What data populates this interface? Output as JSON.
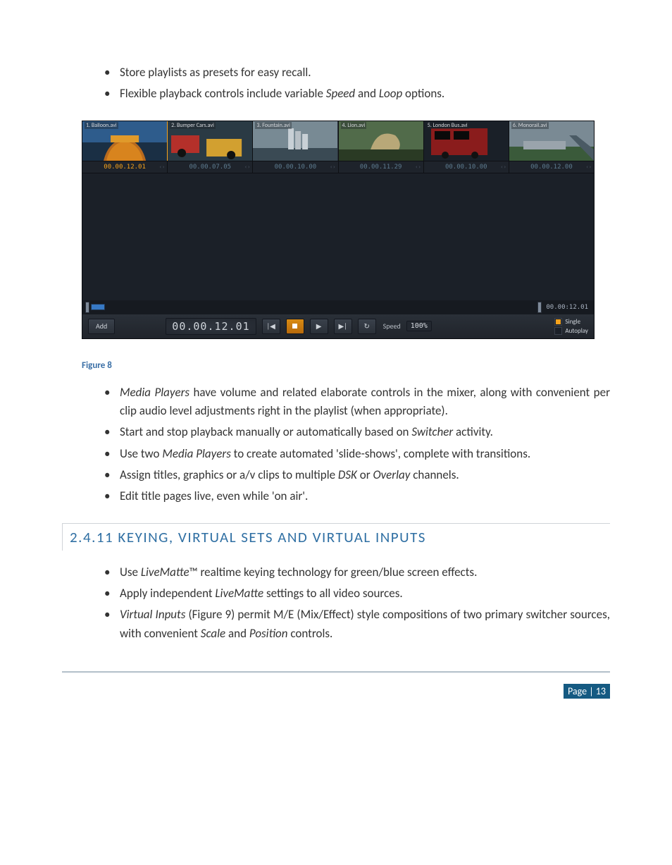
{
  "bullets_top": [
    "Store playlists as presets for easy recall.",
    "Flexible playback controls include variable <em>Speed</em> and <em>Loop</em> options."
  ],
  "figure": {
    "thumbs": [
      {
        "name": "1. Balloon.avi",
        "time": "00.00.12.01",
        "selected": true
      },
      {
        "name": "2. Bumper Cars.avi",
        "time": "00.00.07.05",
        "selected": false
      },
      {
        "name": "3. Fountain.avi",
        "time": "00.00.10.00",
        "selected": false
      },
      {
        "name": "4. Lion.avi",
        "time": "00.00.11.29",
        "selected": false
      },
      {
        "name": "5. London Bus.avi",
        "time": "00.00.10.00",
        "selected": false
      },
      {
        "name": "6. Monorail.avi",
        "time": "00.00.12.00",
        "selected": false
      }
    ],
    "track_dur": "00.00:12.01",
    "controls": {
      "add": "Add",
      "timecode": "00.00.12.01",
      "speed_label": "Speed",
      "speed_value": "100%",
      "chk_single": "Single",
      "chk_autoplay": "Autoplay"
    }
  },
  "caption": "Figure 8",
  "bullets_mid": [
    "<em>Media Players</em> have volume and related elaborate controls in the mixer, along with convenient per clip audio level adjustments right in the playlist (when appropriate).",
    "Start and stop playback manually or automatically based on <em>Switcher</em> activity.",
    "Use two <em>Media Players</em> to create automated 'slide-shows', complete with transitions.",
    "Assign titles, graphics or a/v clips to multiple <em>DSK</em> or <em>Overlay</em> channels.",
    "Edit title pages live, even while 'on air'."
  ],
  "section": "2.4.11 KEYING, VIRTUAL SETS AND VIRTUAL INPUTS",
  "bullets_bot": [
    "Use <em>LiveMatte</em>™ realtime keying technology for green/blue screen effects.",
    "Apply independent <em>LiveMatte</em> settings to all video sources.",
    "<em>Virtual Inputs</em> (Figure 9) permit M/E (Mix/Effect) style compositions of two primary switcher sources, with convenient <em>Scale</em> and <em>Position</em> controls."
  ],
  "footer": "Page | 13"
}
